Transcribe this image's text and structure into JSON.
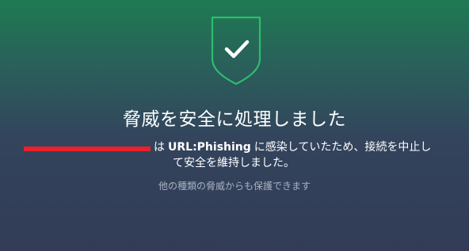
{
  "colors": {
    "accent_green": "#2dbd6e",
    "redaction_red": "#e8212b",
    "subtext": "#a9b1c2"
  },
  "status_icon": "shield-check-icon",
  "heading": "脅威を安全に処理しました",
  "message": {
    "prefix": "は",
    "threat_name": "URL:Phishing",
    "suffix_line1": "に感染していたため、接続を中止し",
    "line2": "て安全を維持しました。"
  },
  "subtext": "他の種類の脅威からも保護できます"
}
